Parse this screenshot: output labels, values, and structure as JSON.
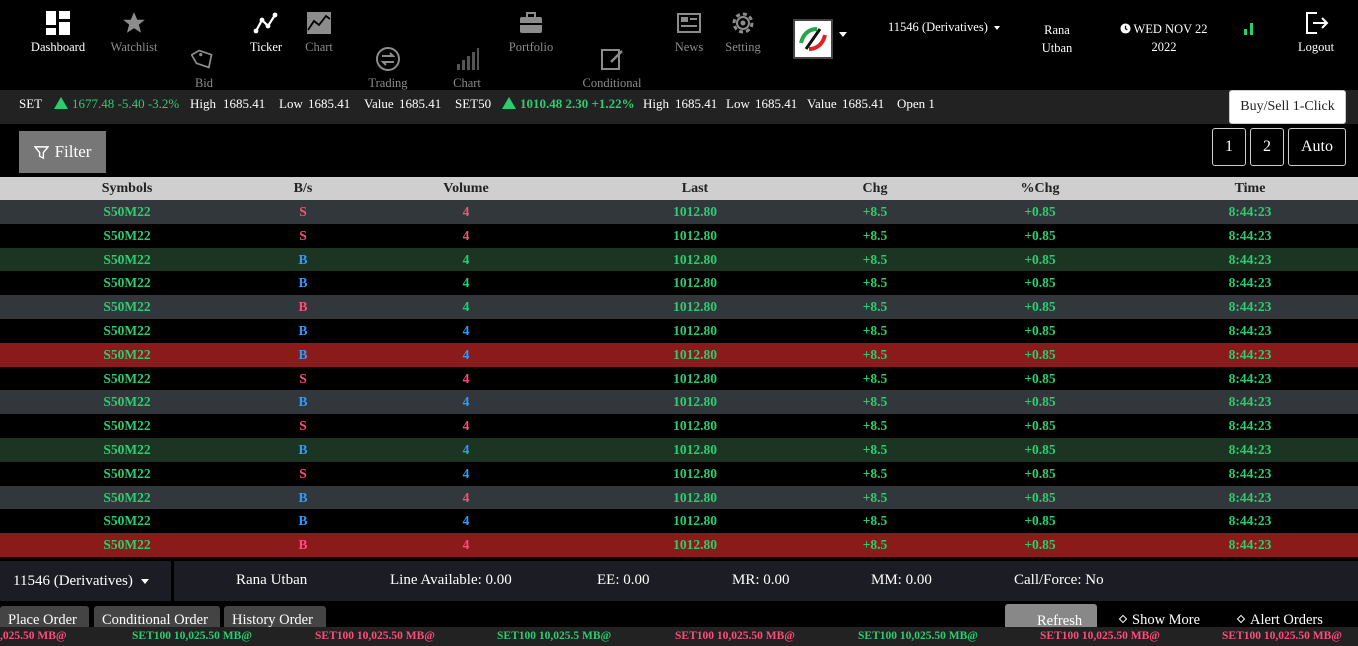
{
  "nav": {
    "items": [
      {
        "label": "Dashboard",
        "icon": "grid-icon",
        "active": true
      },
      {
        "label": "Watchlist",
        "icon": "star-icon",
        "active": false
      },
      {
        "label": "Bid\nOffer",
        "icon": "tag-icon",
        "active": false
      },
      {
        "label": "Ticker",
        "icon": "ticker-line-icon",
        "active": true
      },
      {
        "label": "Chart",
        "icon": "area-chart-icon",
        "active": false
      },
      {
        "label": "Trading\nView",
        "icon": "exchange-icon",
        "active": false
      },
      {
        "label": "Chart\nTBD",
        "icon": "bar-signal-icon",
        "active": false
      },
      {
        "label": "Portfolio",
        "icon": "briefcase-icon",
        "active": false
      },
      {
        "label": "Conditional\nOrder",
        "icon": "edit-doc-icon",
        "active": false
      },
      {
        "label": "News",
        "icon": "newspaper-icon",
        "active": false
      },
      {
        "label": "Setting",
        "icon": "gear-icon",
        "active": false
      }
    ],
    "account_selector": "11546 (Derivatives)",
    "user_name": "Rana Utban",
    "date": "WED NOV 22 2022",
    "logout": "Logout"
  },
  "ticker": {
    "set_label": "SET",
    "set_value": "1677.48 -5.40 -3.2%",
    "high_label": "High",
    "high_value": "1685.41",
    "low_label": "Low",
    "low_value": "1685.41",
    "value_label": "Value",
    "value_value": "1685.41",
    "set50_label": "SET50",
    "set50_value": "1010.48 2.30 +1.22%",
    "high2_value": "1685.41",
    "low2_value": "1685.41",
    "value2_value": "1685.41",
    "open_label": "Open 1"
  },
  "one_click": "Buy/Sell 1-Click",
  "filter": "Filter",
  "pages": [
    "1",
    "2",
    "Auto"
  ],
  "table": {
    "headers": [
      "Symbols",
      "B/s",
      "Volume",
      "Last",
      "Chg",
      "%Chg",
      "Time"
    ],
    "rows": [
      {
        "symbol": "S50M22",
        "bs": "S",
        "volume": "4",
        "last": "1012.80",
        "chg": "+8.5",
        "pct": "+0.85",
        "time": "8:44:23",
        "bg": "#32373c",
        "bs_color": "pink",
        "vol_color": "pink"
      },
      {
        "symbol": "S50M22",
        "bs": "S",
        "volume": "4",
        "last": "1012.80",
        "chg": "+8.5",
        "pct": "+0.85",
        "time": "8:44:23",
        "bg": "#000000",
        "bs_color": "pink",
        "vol_color": "pink"
      },
      {
        "symbol": "S50M22",
        "bs": "B",
        "volume": "4",
        "last": "1012.80",
        "chg": "+8.5",
        "pct": "+0.85",
        "time": "8:44:23",
        "bg": "#1c3522",
        "bs_color": "blue",
        "vol_color": "green"
      },
      {
        "symbol": "S50M22",
        "bs": "B",
        "volume": "4",
        "last": "1012.80",
        "chg": "+8.5",
        "pct": "+0.85",
        "time": "8:44:23",
        "bg": "#000000",
        "bs_color": "blue",
        "vol_color": "green"
      },
      {
        "symbol": "S50M22",
        "bs": "B",
        "volume": "4",
        "last": "1012.80",
        "chg": "+8.5",
        "pct": "+0.85",
        "time": "8:44:23",
        "bg": "#32373c",
        "bs_color": "pink",
        "vol_color": "green"
      },
      {
        "symbol": "S50M22",
        "bs": "B",
        "volume": "4",
        "last": "1012.80",
        "chg": "+8.5",
        "pct": "+0.85",
        "time": "8:44:23",
        "bg": "#000000",
        "bs_color": "blue",
        "vol_color": "blue"
      },
      {
        "symbol": "S50M22",
        "bs": "B",
        "volume": "4",
        "last": "1012.80",
        "chg": "+8.5",
        "pct": "+0.85",
        "time": "8:44:23",
        "bg": "#8b1a1a",
        "bs_color": "blue",
        "vol_color": "blue"
      },
      {
        "symbol": "S50M22",
        "bs": "S",
        "volume": "4",
        "last": "1012.80",
        "chg": "+8.5",
        "pct": "+0.85",
        "time": "8:44:23",
        "bg": "#000000",
        "bs_color": "pink",
        "vol_color": "pink"
      },
      {
        "symbol": "S50M22",
        "bs": "B",
        "volume": "4",
        "last": "1012.80",
        "chg": "+8.5",
        "pct": "+0.85",
        "time": "8:44:23",
        "bg": "#32373c",
        "bs_color": "blue",
        "vol_color": "blue"
      },
      {
        "symbol": "S50M22",
        "bs": "S",
        "volume": "4",
        "last": "1012.80",
        "chg": "+8.5",
        "pct": "+0.85",
        "time": "8:44:23",
        "bg": "#000000",
        "bs_color": "pink",
        "vol_color": "pink"
      },
      {
        "symbol": "S50M22",
        "bs": "B",
        "volume": "4",
        "last": "1012.80",
        "chg": "+8.5",
        "pct": "+0.85",
        "time": "8:44:23",
        "bg": "#1c3522",
        "bs_color": "blue",
        "vol_color": "blue"
      },
      {
        "symbol": "S50M22",
        "bs": "S",
        "volume": "4",
        "last": "1012.80",
        "chg": "+8.5",
        "pct": "+0.85",
        "time": "8:44:23",
        "bg": "#000000",
        "bs_color": "pink",
        "vol_color": "blue"
      },
      {
        "symbol": "S50M22",
        "bs": "B",
        "volume": "4",
        "last": "1012.80",
        "chg": "+8.5",
        "pct": "+0.85",
        "time": "8:44:23",
        "bg": "#32373c",
        "bs_color": "blue",
        "vol_color": "pink"
      },
      {
        "symbol": "S50M22",
        "bs": "B",
        "volume": "4",
        "last": "1012.80",
        "chg": "+8.5",
        "pct": "+0.85",
        "time": "8:44:23",
        "bg": "#000000",
        "bs_color": "blue",
        "vol_color": "blue"
      },
      {
        "symbol": "S50M22",
        "bs": "B",
        "volume": "4",
        "last": "1012.80",
        "chg": "+8.5",
        "pct": "+0.85",
        "time": "8:44:23",
        "bg": "#8b1a1a",
        "bs_color": "pink",
        "vol_color": "pink"
      }
    ]
  },
  "account_bar": {
    "account": "11546 (Derivatives)",
    "name": "Rana Utban",
    "line_available": "Line Available: 0.00",
    "ee": "EE: 0.00",
    "mr": "MR: 0.00",
    "mm": "MM: 0.00",
    "call_force": "Call/Force: No"
  },
  "bottom": {
    "place_order": "Place Order",
    "conditional_order": "Conditional Order",
    "history_order": "History Order",
    "refresh": "Refresh",
    "show_more": "Show More",
    "alert_orders": "Alert Orders"
  },
  "marquee": [
    {
      "text": ",025.50 MB@",
      "color": "pink"
    },
    {
      "text": "SET100 10,025.50 MB@",
      "color": "green"
    },
    {
      "text": "SET100 10,025.50 MB@",
      "color": "pink"
    },
    {
      "text": "SET100 10,025.5 MB@",
      "color": "green"
    },
    {
      "text": "SET100 10,025.50 MB@",
      "color": "pink"
    },
    {
      "text": "SET100 10,025.50 MB@",
      "color": "green"
    },
    {
      "text": "SET100 10,025.50 MB@",
      "color": "pink"
    },
    {
      "text": "SET100 10,025.50 MB@",
      "color": "pink"
    }
  ],
  "colors": {
    "green": "#2ecc71",
    "pink": "#ff4d7a",
    "blue": "#3399ff",
    "header_bg": "#cfcfcf"
  }
}
